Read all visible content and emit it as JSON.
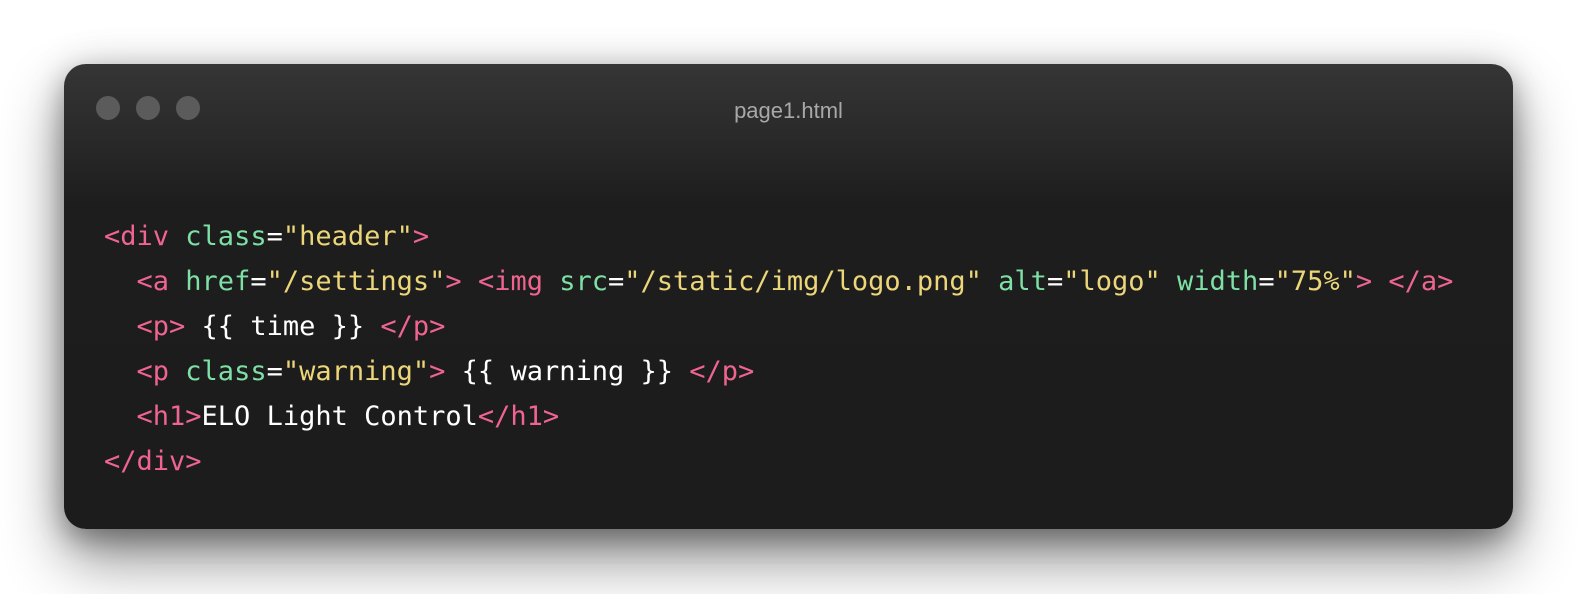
{
  "window": {
    "title": "page1.html",
    "controls": [
      "close",
      "minimize",
      "maximize"
    ]
  },
  "colors": {
    "background": "#ffffff",
    "window_bg": "#1c1c1c",
    "title_text": "#a8a8a8",
    "tag": "#ef6490",
    "attribute": "#7ee0a5",
    "string": "#ecd67a",
    "text": "#ffffff"
  },
  "code": {
    "language": "html",
    "lines": [
      [
        {
          "t": "tag",
          "v": "<div"
        },
        {
          "t": "txt",
          "v": " "
        },
        {
          "t": "attr",
          "v": "class"
        },
        {
          "t": "eq",
          "v": "="
        },
        {
          "t": "str",
          "v": "\"header\""
        },
        {
          "t": "tag",
          "v": ">"
        }
      ],
      [
        {
          "t": "txt",
          "v": "  "
        },
        {
          "t": "tag",
          "v": "<a"
        },
        {
          "t": "txt",
          "v": " "
        },
        {
          "t": "attr",
          "v": "href"
        },
        {
          "t": "eq",
          "v": "="
        },
        {
          "t": "str",
          "v": "\"/settings\""
        },
        {
          "t": "tag",
          "v": ">"
        },
        {
          "t": "txt",
          "v": " "
        },
        {
          "t": "tag",
          "v": "<img"
        },
        {
          "t": "txt",
          "v": " "
        },
        {
          "t": "attr",
          "v": "src"
        },
        {
          "t": "eq",
          "v": "="
        },
        {
          "t": "str",
          "v": "\"/static/img/logo.png\""
        },
        {
          "t": "txt",
          "v": " "
        },
        {
          "t": "attr",
          "v": "alt"
        },
        {
          "t": "eq",
          "v": "="
        },
        {
          "t": "str",
          "v": "\"logo\""
        },
        {
          "t": "txt",
          "v": " "
        },
        {
          "t": "attr",
          "v": "width"
        },
        {
          "t": "eq",
          "v": "="
        },
        {
          "t": "str",
          "v": "\"75%\""
        },
        {
          "t": "tag",
          "v": ">"
        },
        {
          "t": "txt",
          "v": " "
        },
        {
          "t": "tag",
          "v": "</a>"
        }
      ],
      [
        {
          "t": "txt",
          "v": "  "
        },
        {
          "t": "tag",
          "v": "<p>"
        },
        {
          "t": "txt",
          "v": " {{ time }} "
        },
        {
          "t": "tag",
          "v": "</p>"
        }
      ],
      [
        {
          "t": "txt",
          "v": "  "
        },
        {
          "t": "tag",
          "v": "<p"
        },
        {
          "t": "txt",
          "v": " "
        },
        {
          "t": "attr",
          "v": "class"
        },
        {
          "t": "eq",
          "v": "="
        },
        {
          "t": "str",
          "v": "\"warning\""
        },
        {
          "t": "tag",
          "v": ">"
        },
        {
          "t": "txt",
          "v": " {{ warning }} "
        },
        {
          "t": "tag",
          "v": "</p>"
        }
      ],
      [
        {
          "t": "txt",
          "v": "  "
        },
        {
          "t": "tag",
          "v": "<h1>"
        },
        {
          "t": "txt",
          "v": "ELO Light Control"
        },
        {
          "t": "tag",
          "v": "</h1>"
        }
      ],
      [
        {
          "t": "tag",
          "v": "</div>"
        }
      ]
    ]
  }
}
